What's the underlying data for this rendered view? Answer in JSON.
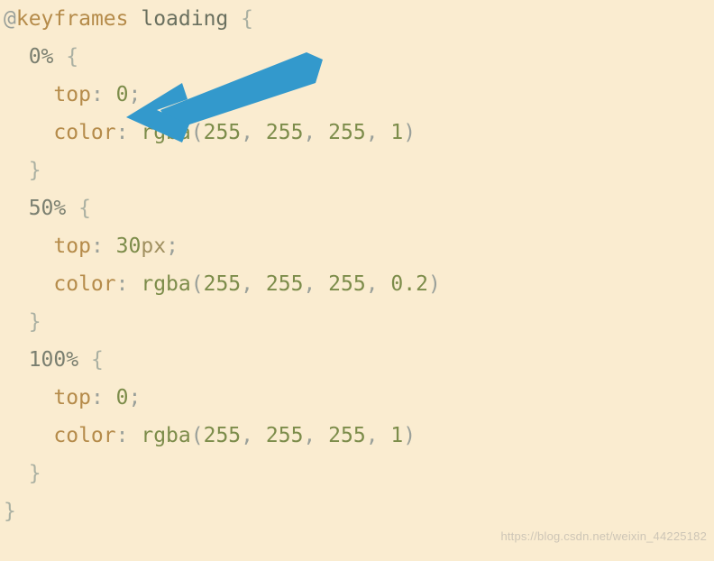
{
  "code": {
    "at": "@",
    "keyframes": "keyframes",
    "animName": "loading",
    "ob": "{",
    "cb": "}",
    "op": "(",
    "cp": ")",
    "comma": ",",
    "semi": ";",
    "colon": ":",
    "pct0": "0%",
    "pct50": "50%",
    "pct100": "100%",
    "top": "top",
    "color": "color",
    "zero": "0",
    "thirty": "30",
    "px": "px",
    "rgba": "rgba",
    "a1_1": "255",
    "a1_2": "255",
    "a1_3": "255",
    "a1_4": "1",
    "a2_1": "255",
    "a2_2": "255",
    "a2_3": "255",
    "a2_4": "0.2",
    "a3_1": "255",
    "a3_2": "255",
    "a3_3": "255",
    "a3_4": "1"
  },
  "watermark": "https://blog.csdn.net/weixin_44225182",
  "arrow_color": "#3399cc"
}
